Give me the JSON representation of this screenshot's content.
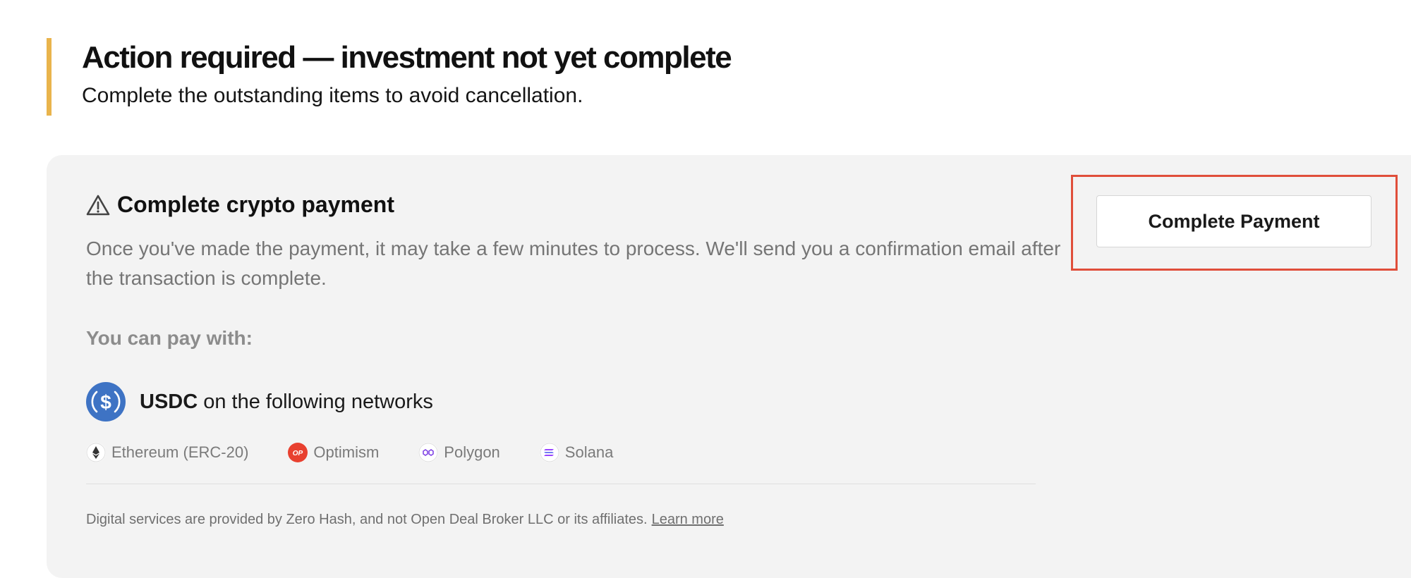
{
  "alert": {
    "title": "Action required — investment not yet complete",
    "subtitle": "Complete the outstanding items to avoid cancellation.",
    "accent_color": "#e9b44c"
  },
  "payment_card": {
    "title": "Complete crypto payment",
    "title_icon": "warning-triangle-icon",
    "description": "Once you've made the payment, it may take a few minutes to process. We'll send you a confirmation email after the transaction is complete.",
    "pay_with_label": "You can pay with:",
    "currency": {
      "icon": "usdc-icon",
      "name": "USDC",
      "suffix": "on the following networks"
    },
    "networks": [
      {
        "icon": "ethereum-icon",
        "label": "Ethereum (ERC-20)"
      },
      {
        "icon": "optimism-icon",
        "label": "Optimism"
      },
      {
        "icon": "polygon-icon",
        "label": "Polygon"
      },
      {
        "icon": "solana-icon",
        "label": "Solana"
      }
    ],
    "disclaimer": "Digital services are provided by Zero Hash, and not Open Deal Broker LLC or its affiliates.",
    "learn_more": "Learn more",
    "button_label": "Complete Payment"
  },
  "colors": {
    "highlight": "#e04e3a",
    "card_bg": "#f3f3f3",
    "usdc_blue": "#3e73c4",
    "optimism_red": "#ff0420"
  }
}
